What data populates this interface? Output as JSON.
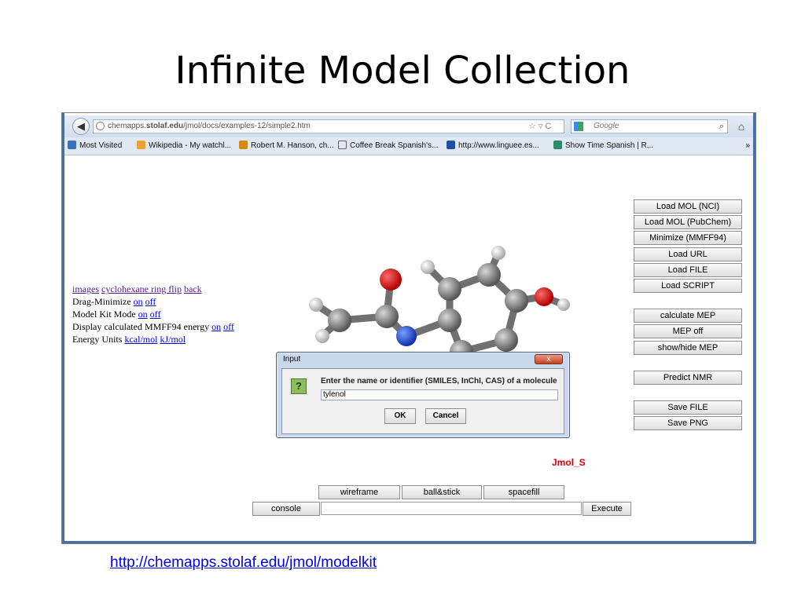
{
  "slide": {
    "title": "Infinite Model Collection",
    "footer_link": "http://chemapps.stolaf.edu/jmol/modelkit"
  },
  "browser": {
    "url_prefix": "chemapps.",
    "url_domain": "stolaf.edu",
    "url_path": "/jmol/docs/examples-12/simple2.htm",
    "url_tools": "☆ ▿ C",
    "search_placeholder": "Google",
    "bookmarks": [
      {
        "label": "Most Visited",
        "icon": "most-visited-icon",
        "color": "#3b6fb6"
      },
      {
        "label": "Wikipedia - My watchl...",
        "icon": "rss-feed-icon",
        "color": "#f0a030"
      },
      {
        "label": "Robert M. Hanson, ch...",
        "icon": "bookmark-favicon-icon",
        "color": "#d38a14"
      },
      {
        "label": "Coffee Break Spanish's...",
        "icon": "cloud-icon",
        "color": "#666666"
      },
      {
        "label": "http://www.linguee.es...",
        "icon": "linguee-icon",
        "color": "#1f4fa0"
      },
      {
        "label": "Show Time Spanish | R...",
        "icon": "live-bookmark-icon",
        "color": "#2c8a70"
      }
    ],
    "bookmarks_more": "»"
  },
  "left_panel": {
    "nav_links": [
      "images",
      "cyclohexane ring flip",
      "back"
    ],
    "drag_minimize": {
      "label": "Drag-Minimize",
      "on": "on",
      "off": "off"
    },
    "model_kit_mode": {
      "label": "Model Kit Mode",
      "on": "on",
      "off": "off"
    },
    "display_energy": {
      "label": "Display calculated MMFF94 energy",
      "on": "on",
      "off": "off"
    },
    "energy_units": {
      "label": "Energy Units",
      "kcal": "kcal/mol",
      "kj": "kJ/mol"
    }
  },
  "right_buttons": [
    "Load MOL (NCI)",
    "Load MOL (PubChem)",
    "Minimize (MMFF94)",
    "Load URL",
    "Load FILE",
    "Load SCRIPT",
    "calculate MEP",
    "MEP off",
    "show/hide MEP",
    "Predict NMR",
    "Save FILE",
    "Save PNG"
  ],
  "dialog": {
    "title": "Input",
    "close_label": "x",
    "icon_glyph": "?",
    "message": "Enter the name or identifier (SMILES, InChI, CAS) of a molecule",
    "input_value": "tylenol",
    "ok_label": "OK",
    "cancel_label": "Cancel"
  },
  "jmol": {
    "label": "Jmol_S",
    "label_color": "#e60000"
  },
  "bottom_buttons": {
    "wireframe": "wireframe",
    "ball_stick": "ball&stick",
    "spacefill": "spacefill",
    "console": "console",
    "execute": "Execute"
  },
  "colors": {
    "window_border": "#4a6fa0",
    "link_visited": "#551a8b",
    "link": "#0000ee"
  }
}
